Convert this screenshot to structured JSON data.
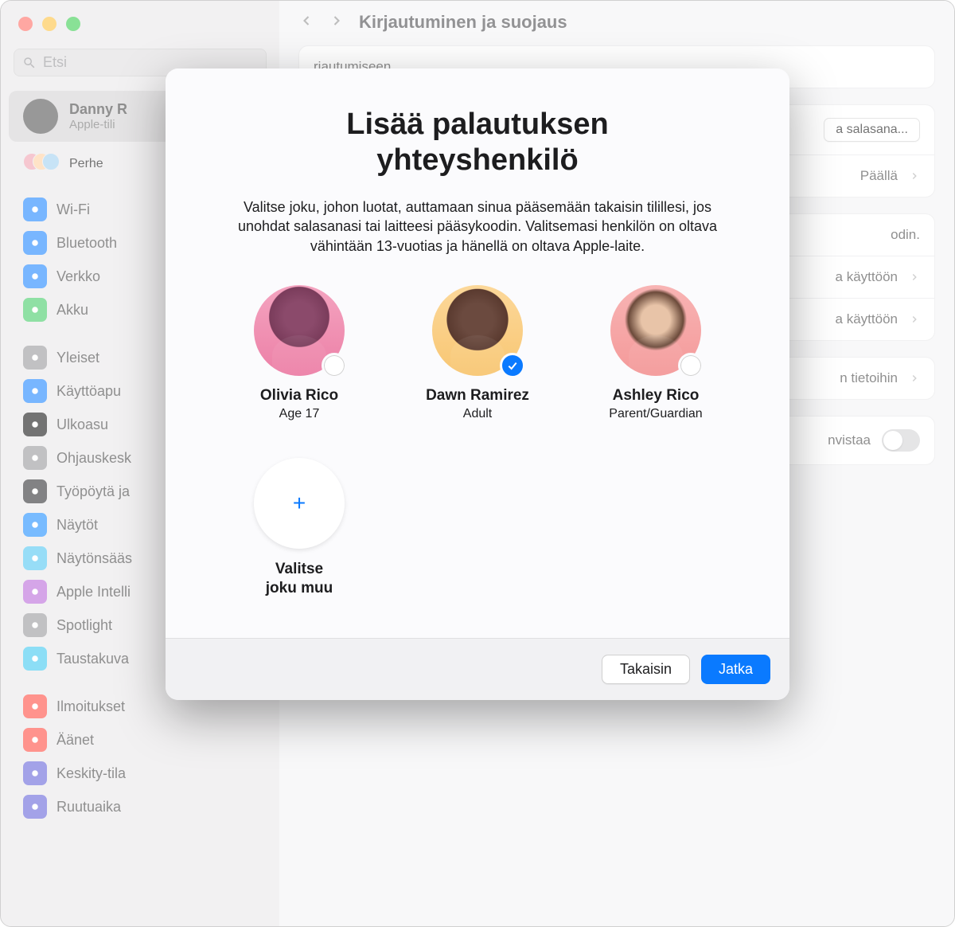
{
  "window": {
    "page_title": "Kirjautuminen ja suojaus",
    "search_placeholder": "Etsi"
  },
  "account": {
    "name": "Danny R",
    "subtitle": "Apple-tili",
    "family_label": "Perhe"
  },
  "sidebar": {
    "items": [
      {
        "label": "Wi-Fi",
        "color": "#0a7aff"
      },
      {
        "label": "Bluetooth",
        "color": "#0a7aff"
      },
      {
        "label": "Verkko",
        "color": "#0a7aff"
      },
      {
        "label": "Akku",
        "color": "#34c759"
      },
      {
        "label": "Yleiset",
        "color": "#8e8e93"
      },
      {
        "label": "Käyttöapu",
        "color": "#0a7aff"
      },
      {
        "label": "Ulkoasu",
        "color": "#000000"
      },
      {
        "label": "Ohjauskesk",
        "color": "#8e8e93"
      },
      {
        "label": "Työpöytä ja",
        "color": "#1d1d1f"
      },
      {
        "label": "Näytöt",
        "color": "#0a84ff"
      },
      {
        "label": "Näytönsääs",
        "color": "#42c1f0"
      },
      {
        "label": "Apple Intelli",
        "color": "#b35bd6"
      },
      {
        "label": "Spotlight",
        "color": "#8e8e93"
      },
      {
        "label": "Taustakuva",
        "color": "#2fc4ef"
      },
      {
        "label": "Ilmoitukset",
        "color": "#ff3b30"
      },
      {
        "label": "Äänet",
        "color": "#ff3b30"
      },
      {
        "label": "Keskity-tila",
        "color": "#5856d6"
      },
      {
        "label": "Ruutuaika",
        "color": "#5856d6"
      }
    ]
  },
  "content": {
    "row1_text": "rjautumiseen.",
    "change_password": "a salasana...",
    "on_label": "Päällä",
    "row_odin": "odin.",
    "row_kayttoon1": "a käyttöön",
    "row_kayttoon2": "a käyttöön",
    "row_tietoihin": "n tietoihin",
    "row_vistaa": "nvistaa"
  },
  "modal": {
    "title_line1": "Lisää palautuksen",
    "title_line2": "yhteyshenkilö",
    "description": "Valitse joku, johon luotat, auttamaan sinua pääsemään takaisin tilillesi, jos unohdat salasanasi tai laitteesi pääsykoodin. Valitsemasi henkilön on oltava vähintään 13-vuotias ja hänellä on oltava Apple-laite.",
    "contacts": [
      {
        "name": "Olivia Rico",
        "role": "Age 17",
        "selected": false
      },
      {
        "name": "Dawn Ramirez",
        "role": "Adult",
        "selected": true
      },
      {
        "name": "Ashley Rico",
        "role": "Parent/Guardian",
        "selected": false
      }
    ],
    "add_label_line1": "Valitse",
    "add_label_line2": "joku muu",
    "back_button": "Takaisin",
    "continue_button": "Jatka"
  }
}
